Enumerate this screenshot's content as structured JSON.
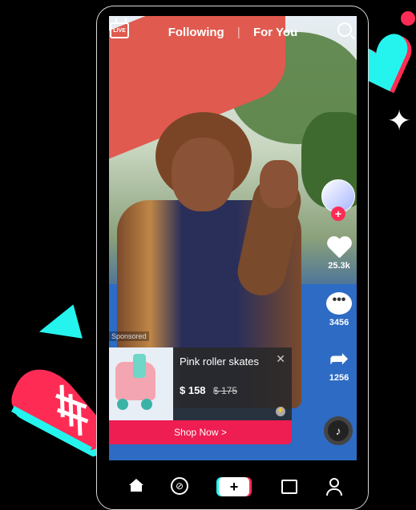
{
  "top_nav": {
    "live_label": "LIVE",
    "following_label": "Following",
    "separator": "|",
    "for_you_label": "For You"
  },
  "right_rail": {
    "like_count": "25.3k",
    "comment_count": "3456",
    "share_count": "1256",
    "follow_symbol": "+"
  },
  "ad": {
    "sponsored_label": "Sponsored",
    "product_title": "Pink roller skates",
    "price": "$ 158",
    "original_price": "$ 175",
    "close_symbol": "✕",
    "cta_label": "Shop Now  >"
  },
  "tabbar": {
    "create_symbol": "+"
  },
  "colors": {
    "brand_red": "#fe2c55",
    "brand_cyan": "#25f4ee",
    "cta_red": "#ee1d52"
  },
  "icons": [
    "live-icon",
    "search-icon",
    "heart-icon",
    "comment-icon",
    "share-icon",
    "music-disc-icon",
    "home-icon",
    "discover-icon",
    "create-icon",
    "inbox-icon",
    "profile-icon"
  ]
}
